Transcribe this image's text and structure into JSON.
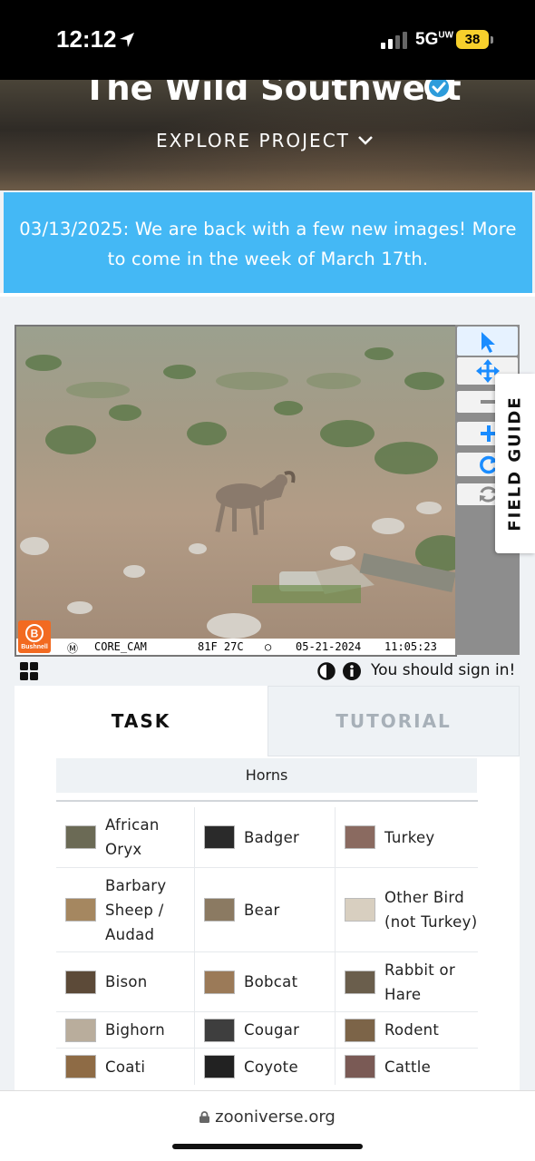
{
  "status_bar": {
    "time": "12:12",
    "network": "5G",
    "network_sup": "UW",
    "battery": "38"
  },
  "header": {
    "title": "The Wild Southwest",
    "explore_label": "EXPLORE PROJECT"
  },
  "announcement": {
    "line1": "03/13/2025: We are back with a few new images! More",
    "line2": "to come in the week of March 17th."
  },
  "camera_strip": {
    "brand": "Bushnell",
    "camera": "CORE_CAM",
    "temp": "81F 27C",
    "date": "05-21-2024",
    "time": "11:05:23"
  },
  "field_guide": {
    "label": "FIELD GUIDE"
  },
  "meta": {
    "signin_text": "You should sign in!"
  },
  "tabs": [
    {
      "label": "TASK",
      "active": true
    },
    {
      "label": "TUTORIAL",
      "active": false
    }
  ],
  "filter": {
    "label": "Horns"
  },
  "choices": [
    {
      "label": "African Oryx",
      "lines": [
        "African",
        "Oryx"
      ],
      "thumb": "#6b6a55"
    },
    {
      "label": "Badger",
      "lines": [
        "Badger"
      ],
      "thumb": "#2a2a2a"
    },
    {
      "label": "Turkey",
      "lines": [
        "Turkey"
      ],
      "thumb": "#8a6a60"
    },
    {
      "label": "Barbary Sheep / Audad",
      "lines": [
        "Barbary",
        "Sheep /",
        "Audad"
      ],
      "thumb": "#a58760"
    },
    {
      "label": "Bear",
      "lines": [
        "Bear"
      ],
      "thumb": "#8b7a62"
    },
    {
      "label": "Other Bird (not Turkey)",
      "lines": [
        "Other Bird",
        "(not Turkey)"
      ],
      "thumb": "#d8cfc0"
    },
    {
      "label": "Bison",
      "lines": [
        "Bison"
      ],
      "thumb": "#5c4a38"
    },
    {
      "label": "Bobcat",
      "lines": [
        "Bobcat"
      ],
      "thumb": "#9b7a58"
    },
    {
      "label": "Rabbit or Hare",
      "lines": [
        "Rabbit or",
        "Hare"
      ],
      "thumb": "#6a5e4c"
    },
    {
      "label": "Bighorn",
      "lines": [
        "Bighorn"
      ],
      "thumb": "#b9ad9c"
    },
    {
      "label": "Cougar",
      "lines": [
        "Cougar"
      ],
      "thumb": "#3e3e3e"
    },
    {
      "label": "Rodent",
      "lines": [
        "Rodent"
      ],
      "thumb": "#7c6448"
    },
    {
      "label": "Coati",
      "lines": [
        "Coati"
      ],
      "thumb": "#8e6b45"
    },
    {
      "label": "Coyote",
      "lines": [
        "Coyote"
      ],
      "thumb": "#222222"
    },
    {
      "label": "Cattle",
      "lines": [
        "Cattle"
      ],
      "thumb": "#7a5a55"
    }
  ],
  "browser": {
    "url": "zooniverse.org"
  },
  "colors": {
    "accent": "#44b8f5",
    "tool_active": "#1a8cff",
    "bushnell": "#f26a21"
  }
}
